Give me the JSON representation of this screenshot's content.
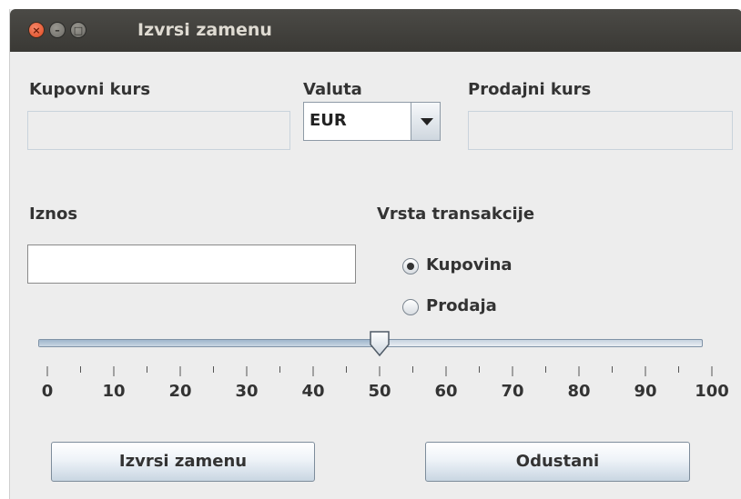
{
  "window": {
    "title": "Izvrsi zamenu",
    "close_glyph": "×",
    "min_glyph": "–",
    "max_glyph": "□"
  },
  "exchange": {
    "buy_rate_label": "Kupovni kurs",
    "buy_rate_value": "",
    "currency_label": "Valuta",
    "currency_selected": "EUR",
    "sell_rate_label": "Prodajni kurs",
    "sell_rate_value": ""
  },
  "amount": {
    "label": "Iznos",
    "value": ""
  },
  "transaction": {
    "label": "Vrsta transakcije",
    "options": [
      {
        "label": "Kupovina",
        "selected": true
      },
      {
        "label": "Prodaja",
        "selected": false
      }
    ]
  },
  "slider": {
    "min": 0,
    "max": 100,
    "value": 50,
    "major_ticks": [
      "0",
      "10",
      "20",
      "30",
      "40",
      "50",
      "60",
      "70",
      "80",
      "90",
      "100"
    ]
  },
  "buttons": {
    "execute_label": "Izvrsi zamenu",
    "cancel_label": "Odustani"
  },
  "colors": {
    "titlebar": "#3c3b37",
    "window_bg": "#ededed",
    "close_button": "#e5532b"
  }
}
